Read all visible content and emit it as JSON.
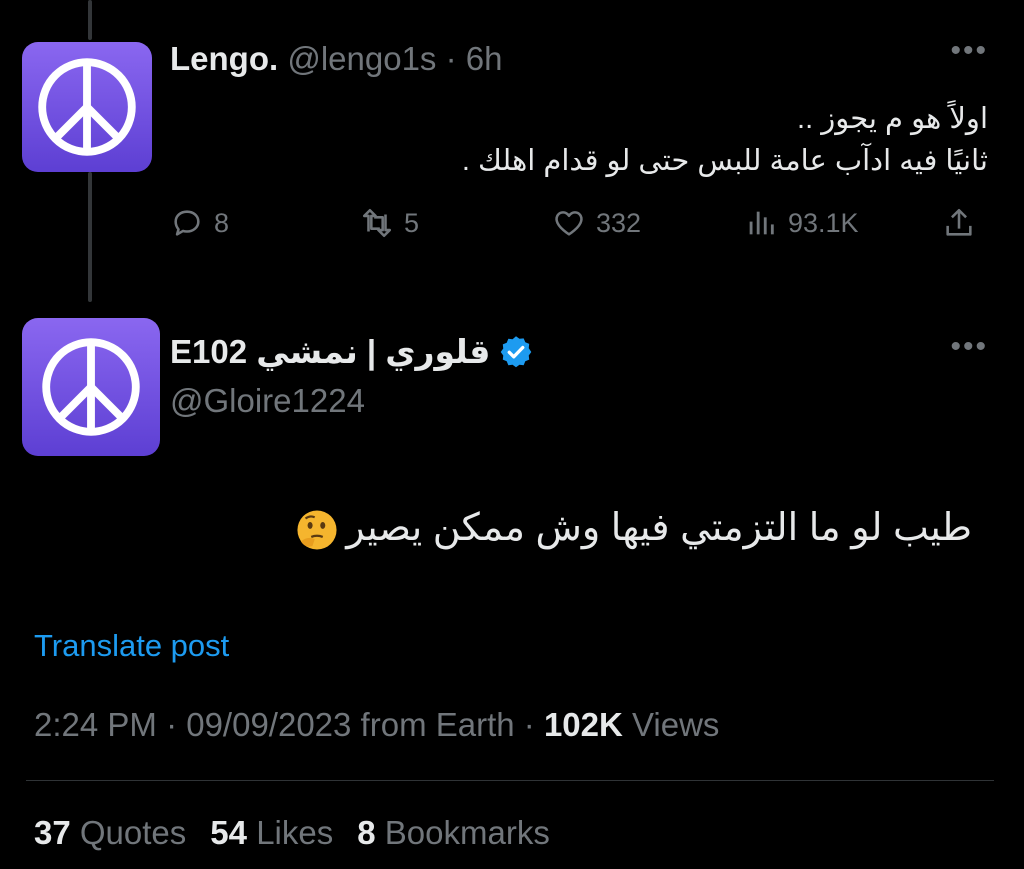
{
  "parent_tweet": {
    "name": "Lengo.",
    "handle": "@lengo1s",
    "time": "6h",
    "text_line1": "اولاً هو م يجوز ..",
    "text_line2": "ثانيًا فيه ادآب عامة للبس حتى لو قدام اهلك .",
    "replies": "8",
    "retweets": "5",
    "likes": "332",
    "views": "93.1K"
  },
  "main_tweet": {
    "display_name": "قلوري | نمشي E102",
    "handle": "@Gloire1224",
    "text": "طيب لو ما التزمتي فيها وش ممكن يصير",
    "translate_label": "Translate post",
    "timestamp": "2:24 PM · 09/09/2023 from Earth ·",
    "views_count": "102K",
    "views_label": "Views",
    "quotes_count": "37",
    "quotes_label": "Quotes",
    "likes_count": "54",
    "likes_label": "Likes",
    "bookmarks_count": "8",
    "bookmarks_label": "Bookmarks"
  },
  "icons": {
    "avatar": "peace-icon",
    "reply": "reply-icon",
    "retweet": "retweet-icon",
    "like": "heart-icon",
    "views": "views-icon",
    "share": "share-icon",
    "verified": "verified-badge-icon",
    "more": "more-icon"
  },
  "colors": {
    "background": "#000000",
    "accent": "#1d9bf0",
    "avatar": "#6b4ce0",
    "muted": "#71767b"
  }
}
